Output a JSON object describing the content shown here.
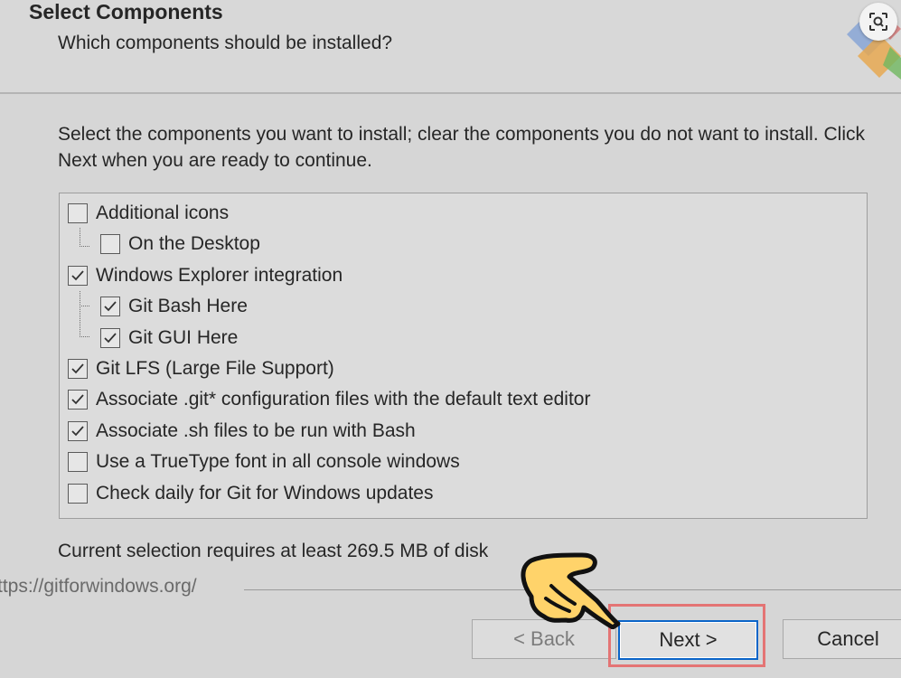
{
  "header": {
    "title": "Select Components",
    "subtitle": "Which components should be installed?"
  },
  "instructions": "Select the components you want to install; clear the components you do not want to install. Click Next when you are ready to continue.",
  "components": [
    {
      "label": "Additional icons",
      "checked": false,
      "level": 0
    },
    {
      "label": "On the Desktop",
      "checked": false,
      "level": 1
    },
    {
      "label": "Windows Explorer integration",
      "checked": true,
      "level": 0
    },
    {
      "label": "Git Bash Here",
      "checked": true,
      "level": 1
    },
    {
      "label": "Git GUI Here",
      "checked": true,
      "level": 1
    },
    {
      "label": "Git LFS (Large File Support)",
      "checked": true,
      "level": 0
    },
    {
      "label": "Associate .git* configuration files with the default text editor",
      "checked": true,
      "level": 0
    },
    {
      "label": "Associate .sh files to be run with Bash",
      "checked": true,
      "level": 0
    },
    {
      "label": "Use a TrueType font in all console windows",
      "checked": false,
      "level": 0
    },
    {
      "label": "Check daily for Git for Windows updates",
      "checked": false,
      "level": 0
    }
  ],
  "disk_text": "Current selection requires at least 269.5 MB of disk",
  "url_text": "ttps://gitforwindows.org/",
  "buttons": {
    "back": "< Back",
    "next": "Next >",
    "cancel": "Cancel"
  },
  "icons": {
    "logo": "git-installer-logo-icon",
    "zoom": "visual-search-icon",
    "pointer": "pointing-hand-icon"
  },
  "colors": {
    "highlight": "#e47474",
    "focus_border": "#0a64c8",
    "hand_fill": "#ffd36a"
  }
}
